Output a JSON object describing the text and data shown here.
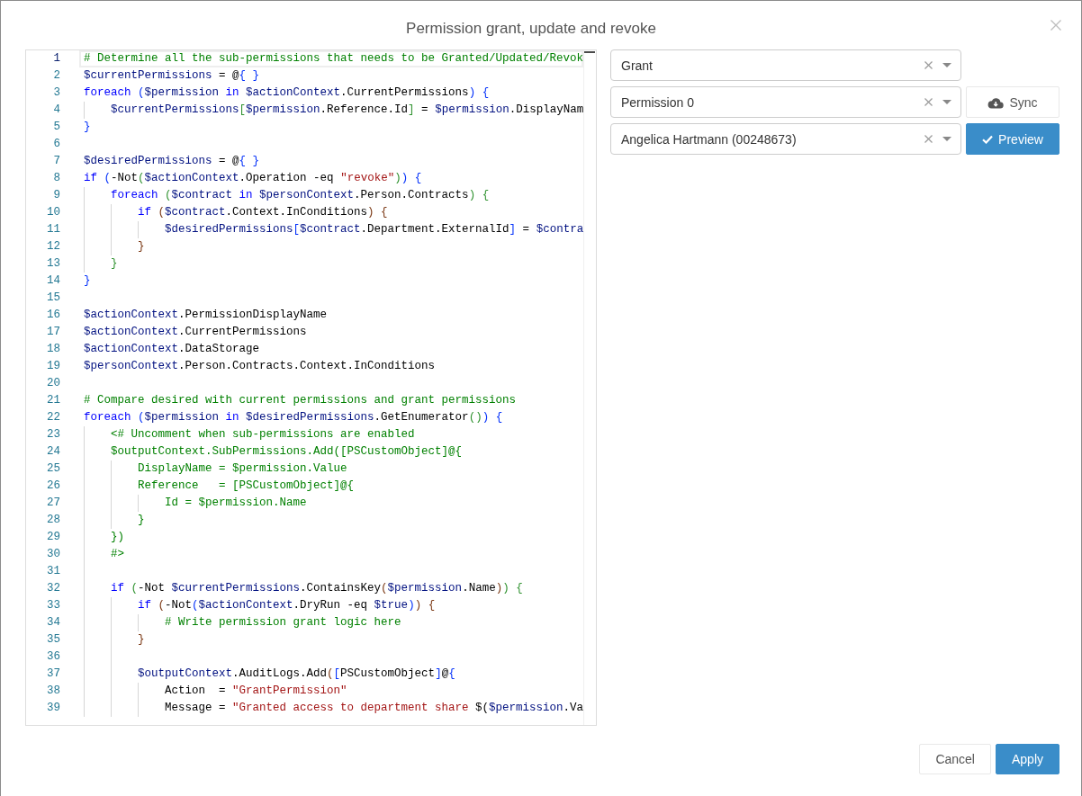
{
  "dialog": {
    "title": "Permission grant, update and revoke"
  },
  "editor": {
    "lines": [
      {
        "number": "1",
        "current": true,
        "tokens": [
          {
            "kind": "comment",
            "text": "# Determine all the sub-permissions that needs to be Granted/Updated/Revok"
          }
        ]
      },
      {
        "number": "2",
        "current": false,
        "tokens": [
          {
            "kind": "variable",
            "text": "$currentPermissions"
          },
          {
            "kind": "plain",
            "text": " = @"
          },
          {
            "kind": "bracket1",
            "text": "{ }"
          }
        ]
      },
      {
        "number": "3",
        "current": false,
        "tokens": [
          {
            "kind": "keyword",
            "text": "foreach "
          },
          {
            "kind": "bracket1",
            "text": "("
          },
          {
            "kind": "variable",
            "text": "$permission "
          },
          {
            "kind": "keyword",
            "text": "in "
          },
          {
            "kind": "variable",
            "text": "$actionContext"
          },
          {
            "kind": "plain",
            "text": ".CurrentPermissions"
          },
          {
            "kind": "bracket1",
            "text": ") {"
          }
        ],
        "children": [
          {
            "number": "4",
            "current": false,
            "tokens": [
              {
                "kind": "variable",
                "text": "$currentPermissions"
              },
              {
                "kind": "bracket2",
                "text": "["
              },
              {
                "kind": "variable",
                "text": "$permission"
              },
              {
                "kind": "plain",
                "text": ".Reference.Id"
              },
              {
                "kind": "bracket2",
                "text": "]"
              },
              {
                "kind": "plain",
                "text": " = "
              },
              {
                "kind": "variable",
                "text": "$permission"
              },
              {
                "kind": "plain",
                "text": ".DisplayNam"
              }
            ]
          }
        ]
      },
      {
        "number": "5",
        "current": false,
        "tokens": [
          {
            "kind": "bracket1",
            "text": "}"
          }
        ]
      },
      {
        "number": "6",
        "current": false
      },
      {
        "number": "7",
        "current": false,
        "tokens": [
          {
            "kind": "variable",
            "text": "$desiredPermissions"
          },
          {
            "kind": "plain",
            "text": " = @"
          },
          {
            "kind": "bracket1",
            "text": "{ }"
          }
        ]
      },
      {
        "number": "8",
        "current": false,
        "tokens": [
          {
            "kind": "keyword",
            "text": "if "
          },
          {
            "kind": "bracket1",
            "text": "("
          },
          {
            "kind": "plain",
            "text": "-Not"
          },
          {
            "kind": "bracket2",
            "text": "("
          },
          {
            "kind": "variable",
            "text": "$actionContext"
          },
          {
            "kind": "plain",
            "text": ".Operation -eq "
          },
          {
            "kind": "string",
            "text": "\"revoke\""
          },
          {
            "kind": "bracket2",
            "text": ")"
          },
          {
            "kind": "bracket1",
            "text": ") {"
          }
        ],
        "children": [
          {
            "number": "9",
            "current": false,
            "tokens": [
              {
                "kind": "keyword",
                "text": "foreach "
              },
              {
                "kind": "bracket2",
                "text": "("
              },
              {
                "kind": "variable",
                "text": "$contract "
              },
              {
                "kind": "keyword",
                "text": "in "
              },
              {
                "kind": "variable",
                "text": "$personContext"
              },
              {
                "kind": "plain",
                "text": ".Person.Contracts"
              },
              {
                "kind": "bracket2",
                "text": ") {"
              }
            ],
            "children": [
              {
                "number": "10",
                "current": false,
                "tokens": [
                  {
                    "kind": "keyword",
                    "text": "if "
                  },
                  {
                    "kind": "bracket3",
                    "text": "("
                  },
                  {
                    "kind": "variable",
                    "text": "$contract"
                  },
                  {
                    "kind": "plain",
                    "text": ".Context.InConditions"
                  },
                  {
                    "kind": "bracket3",
                    "text": ") {"
                  }
                ],
                "children": [
                  {
                    "number": "11",
                    "current": false,
                    "tokens": [
                      {
                        "kind": "variable",
                        "text": "$desiredPermissions"
                      },
                      {
                        "kind": "bracket1",
                        "text": "["
                      },
                      {
                        "kind": "variable",
                        "text": "$contract"
                      },
                      {
                        "kind": "plain",
                        "text": ".Department.ExternalId"
                      },
                      {
                        "kind": "bracket1",
                        "text": "]"
                      },
                      {
                        "kind": "plain",
                        "text": " = "
                      },
                      {
                        "kind": "variable",
                        "text": "$contra"
                      }
                    ]
                  }
                ]
              },
              {
                "number": "12",
                "current": false,
                "tokens": [
                  {
                    "kind": "bracket3",
                    "text": "}"
                  }
                ]
              }
            ]
          },
          {
            "number": "13",
            "current": false,
            "tokens": [
              {
                "kind": "bracket2",
                "text": "}"
              }
            ]
          }
        ]
      },
      {
        "number": "14",
        "current": false,
        "tokens": [
          {
            "kind": "bracket1",
            "text": "}"
          }
        ]
      },
      {
        "number": "15",
        "current": false
      },
      {
        "number": "16",
        "current": false,
        "tokens": [
          {
            "kind": "variable",
            "text": "$actionContext"
          },
          {
            "kind": "plain",
            "text": ".PermissionDisplayName"
          }
        ]
      },
      {
        "number": "17",
        "current": false,
        "tokens": [
          {
            "kind": "variable",
            "text": "$actionContext"
          },
          {
            "kind": "plain",
            "text": ".CurrentPermissions"
          }
        ]
      },
      {
        "number": "18",
        "current": false,
        "tokens": [
          {
            "kind": "variable",
            "text": "$actionContext"
          },
          {
            "kind": "plain",
            "text": ".DataStorage"
          }
        ]
      },
      {
        "number": "19",
        "current": false,
        "tokens": [
          {
            "kind": "variable",
            "text": "$personContext"
          },
          {
            "kind": "plain",
            "text": ".Person.Contracts.Context.InConditions"
          }
        ]
      },
      {
        "number": "20",
        "current": false
      },
      {
        "number": "21",
        "current": false,
        "tokens": [
          {
            "kind": "comment",
            "text": "# Compare desired with current permissions and grant permissions"
          }
        ]
      },
      {
        "number": "22",
        "current": false,
        "tokens": [
          {
            "kind": "keyword",
            "text": "foreach "
          },
          {
            "kind": "bracket1",
            "text": "("
          },
          {
            "kind": "variable",
            "text": "$permission "
          },
          {
            "kind": "keyword",
            "text": "in "
          },
          {
            "kind": "variable",
            "text": "$desiredPermissions"
          },
          {
            "kind": "plain",
            "text": ".GetEnumerator"
          },
          {
            "kind": "bracket2",
            "text": "()"
          },
          {
            "kind": "bracket1",
            "text": ") {"
          }
        ],
        "children": [
          {
            "number": "23",
            "current": false,
            "tokens": [
              {
                "kind": "comment",
                "text": "<# Uncomment when sub-permissions are enabled"
              }
            ]
          },
          {
            "number": "24",
            "current": false,
            "tokens": [
              {
                "kind": "comment",
                "text": "$outputContext.SubPermissions.Add([PSCustomObject]@{"
              }
            ],
            "children": [
              {
                "number": "25",
                "current": false,
                "tokens": [
                  {
                    "kind": "comment",
                    "text": "DisplayName = $permission.Value"
                  }
                ]
              },
              {
                "number": "26",
                "current": false,
                "tokens": [
                  {
                    "kind": "comment",
                    "text": "Reference   = [PSCustomObject]@{"
                  }
                ],
                "children": [
                  {
                    "number": "27",
                    "current": false,
                    "tokens": [
                      {
                        "kind": "comment",
                        "text": "Id = $permission.Name"
                      }
                    ]
                  }
                ]
              },
              {
                "number": "28",
                "current": false,
                "tokens": [
                  {
                    "kind": "comment",
                    "text": "}"
                  }
                ]
              }
            ]
          },
          {
            "number": "29",
            "current": false,
            "tokens": [
              {
                "kind": "comment",
                "text": "})"
              }
            ]
          },
          {
            "number": "30",
            "current": false,
            "tokens": [
              {
                "kind": "comment",
                "text": "#>"
              }
            ]
          },
          {
            "number": "31",
            "current": false
          },
          {
            "number": "32",
            "current": false,
            "tokens": [
              {
                "kind": "keyword",
                "text": "if "
              },
              {
                "kind": "bracket2",
                "text": "("
              },
              {
                "kind": "plain",
                "text": "-Not "
              },
              {
                "kind": "variable",
                "text": "$currentPermissions"
              },
              {
                "kind": "plain",
                "text": ".ContainsKey"
              },
              {
                "kind": "bracket3",
                "text": "("
              },
              {
                "kind": "variable",
                "text": "$permission"
              },
              {
                "kind": "plain",
                "text": ".Name"
              },
              {
                "kind": "bracket3",
                "text": ")"
              },
              {
                "kind": "bracket2",
                "text": ") {"
              }
            ],
            "children": [
              {
                "number": "33",
                "current": false,
                "tokens": [
                  {
                    "kind": "keyword",
                    "text": "if "
                  },
                  {
                    "kind": "bracket3",
                    "text": "("
                  },
                  {
                    "kind": "plain",
                    "text": "-Not"
                  },
                  {
                    "kind": "bracket1",
                    "text": "("
                  },
                  {
                    "kind": "variable",
                    "text": "$actionContext"
                  },
                  {
                    "kind": "plain",
                    "text": ".DryRun -eq "
                  },
                  {
                    "kind": "variable",
                    "text": "$true"
                  },
                  {
                    "kind": "bracket1",
                    "text": ")"
                  },
                  {
                    "kind": "bracket3",
                    "text": ") {"
                  }
                ],
                "children": [
                  {
                    "number": "34",
                    "current": false,
                    "tokens": [
                      {
                        "kind": "comment",
                        "text": "# Write permission grant logic here"
                      }
                    ]
                  }
                ]
              },
              {
                "number": "35",
                "current": false,
                "tokens": [
                  {
                    "kind": "bracket3",
                    "text": "}"
                  }
                ]
              },
              {
                "number": "36",
                "current": false
              },
              {
                "number": "37",
                "current": false,
                "tokens": [
                  {
                    "kind": "variable",
                    "text": "$outputContext"
                  },
                  {
                    "kind": "plain",
                    "text": ".AuditLogs.Add"
                  },
                  {
                    "kind": "bracket3",
                    "text": "("
                  },
                  {
                    "kind": "bracket1",
                    "text": "["
                  },
                  {
                    "kind": "plain",
                    "text": "PSCustomObject"
                  },
                  {
                    "kind": "bracket1",
                    "text": "]"
                  },
                  {
                    "kind": "plain",
                    "text": "@"
                  },
                  {
                    "kind": "bracket1",
                    "text": "{"
                  }
                ],
                "children": [
                  {
                    "number": "38",
                    "current": false,
                    "tokens": [
                      {
                        "kind": "plain",
                        "text": "Action  = "
                      },
                      {
                        "kind": "string",
                        "text": "\"GrantPermission\""
                      }
                    ]
                  },
                  {
                    "number": "39",
                    "current": false,
                    "tokens": [
                      {
                        "kind": "plain",
                        "text": "Message = "
                      },
                      {
                        "kind": "string",
                        "text": "\"Granted access to department share "
                      },
                      {
                        "kind": "plain",
                        "text": "$("
                      },
                      {
                        "kind": "variable",
                        "text": "$permission"
                      },
                      {
                        "kind": "plain",
                        "text": ".Va"
                      }
                    ]
                  }
                ]
              }
            ]
          }
        ]
      }
    ]
  },
  "fields": [
    {
      "value": "Grant"
    },
    {
      "value": "Permission 0",
      "action": {
        "kind": "sync",
        "label": "Sync"
      }
    },
    {
      "value": "Angelica Hartmann (00248673)",
      "action": {
        "kind": "preview",
        "label": "Preview"
      }
    }
  ],
  "footer_buttons": [
    {
      "kind": "cancel",
      "label": "Cancel"
    },
    {
      "kind": "apply",
      "label": "Apply"
    }
  ]
}
